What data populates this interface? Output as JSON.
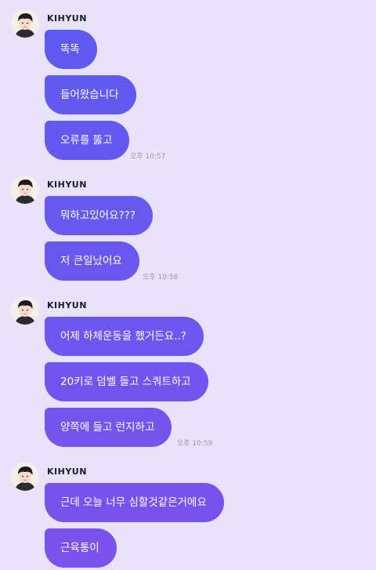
{
  "chat": {
    "groups": [
      {
        "sender": "KIHYUN",
        "messages": [
          "똑똑",
          "들어왔습니다",
          "오류를 뚫고"
        ],
        "time": "오후 10:57"
      },
      {
        "sender": "KIHYUN",
        "messages": [
          "뭐하고있어요???",
          "저 큰일났어요"
        ],
        "time": "오후 10:58"
      },
      {
        "sender": "KIHYUN",
        "messages": [
          "어제 하체운동을 했거든요..?",
          "20키로 덤벨 들고 스쿼트하고",
          "양쪽에 들고 런지하고"
        ],
        "time": "오후 10:59"
      },
      {
        "sender": "KIHYUN",
        "messages": [
          "근데 오늘 너무 심할것같은거에요",
          "근육통이"
        ],
        "time": ""
      }
    ]
  },
  "colors": {
    "background": "#e8e3fb",
    "bubble_top": "#5a5bf2",
    "bubble_bottom": "#7a52ee",
    "timestamp": "#9a96ad"
  },
  "icons": {
    "avatar": "profile-photo"
  }
}
